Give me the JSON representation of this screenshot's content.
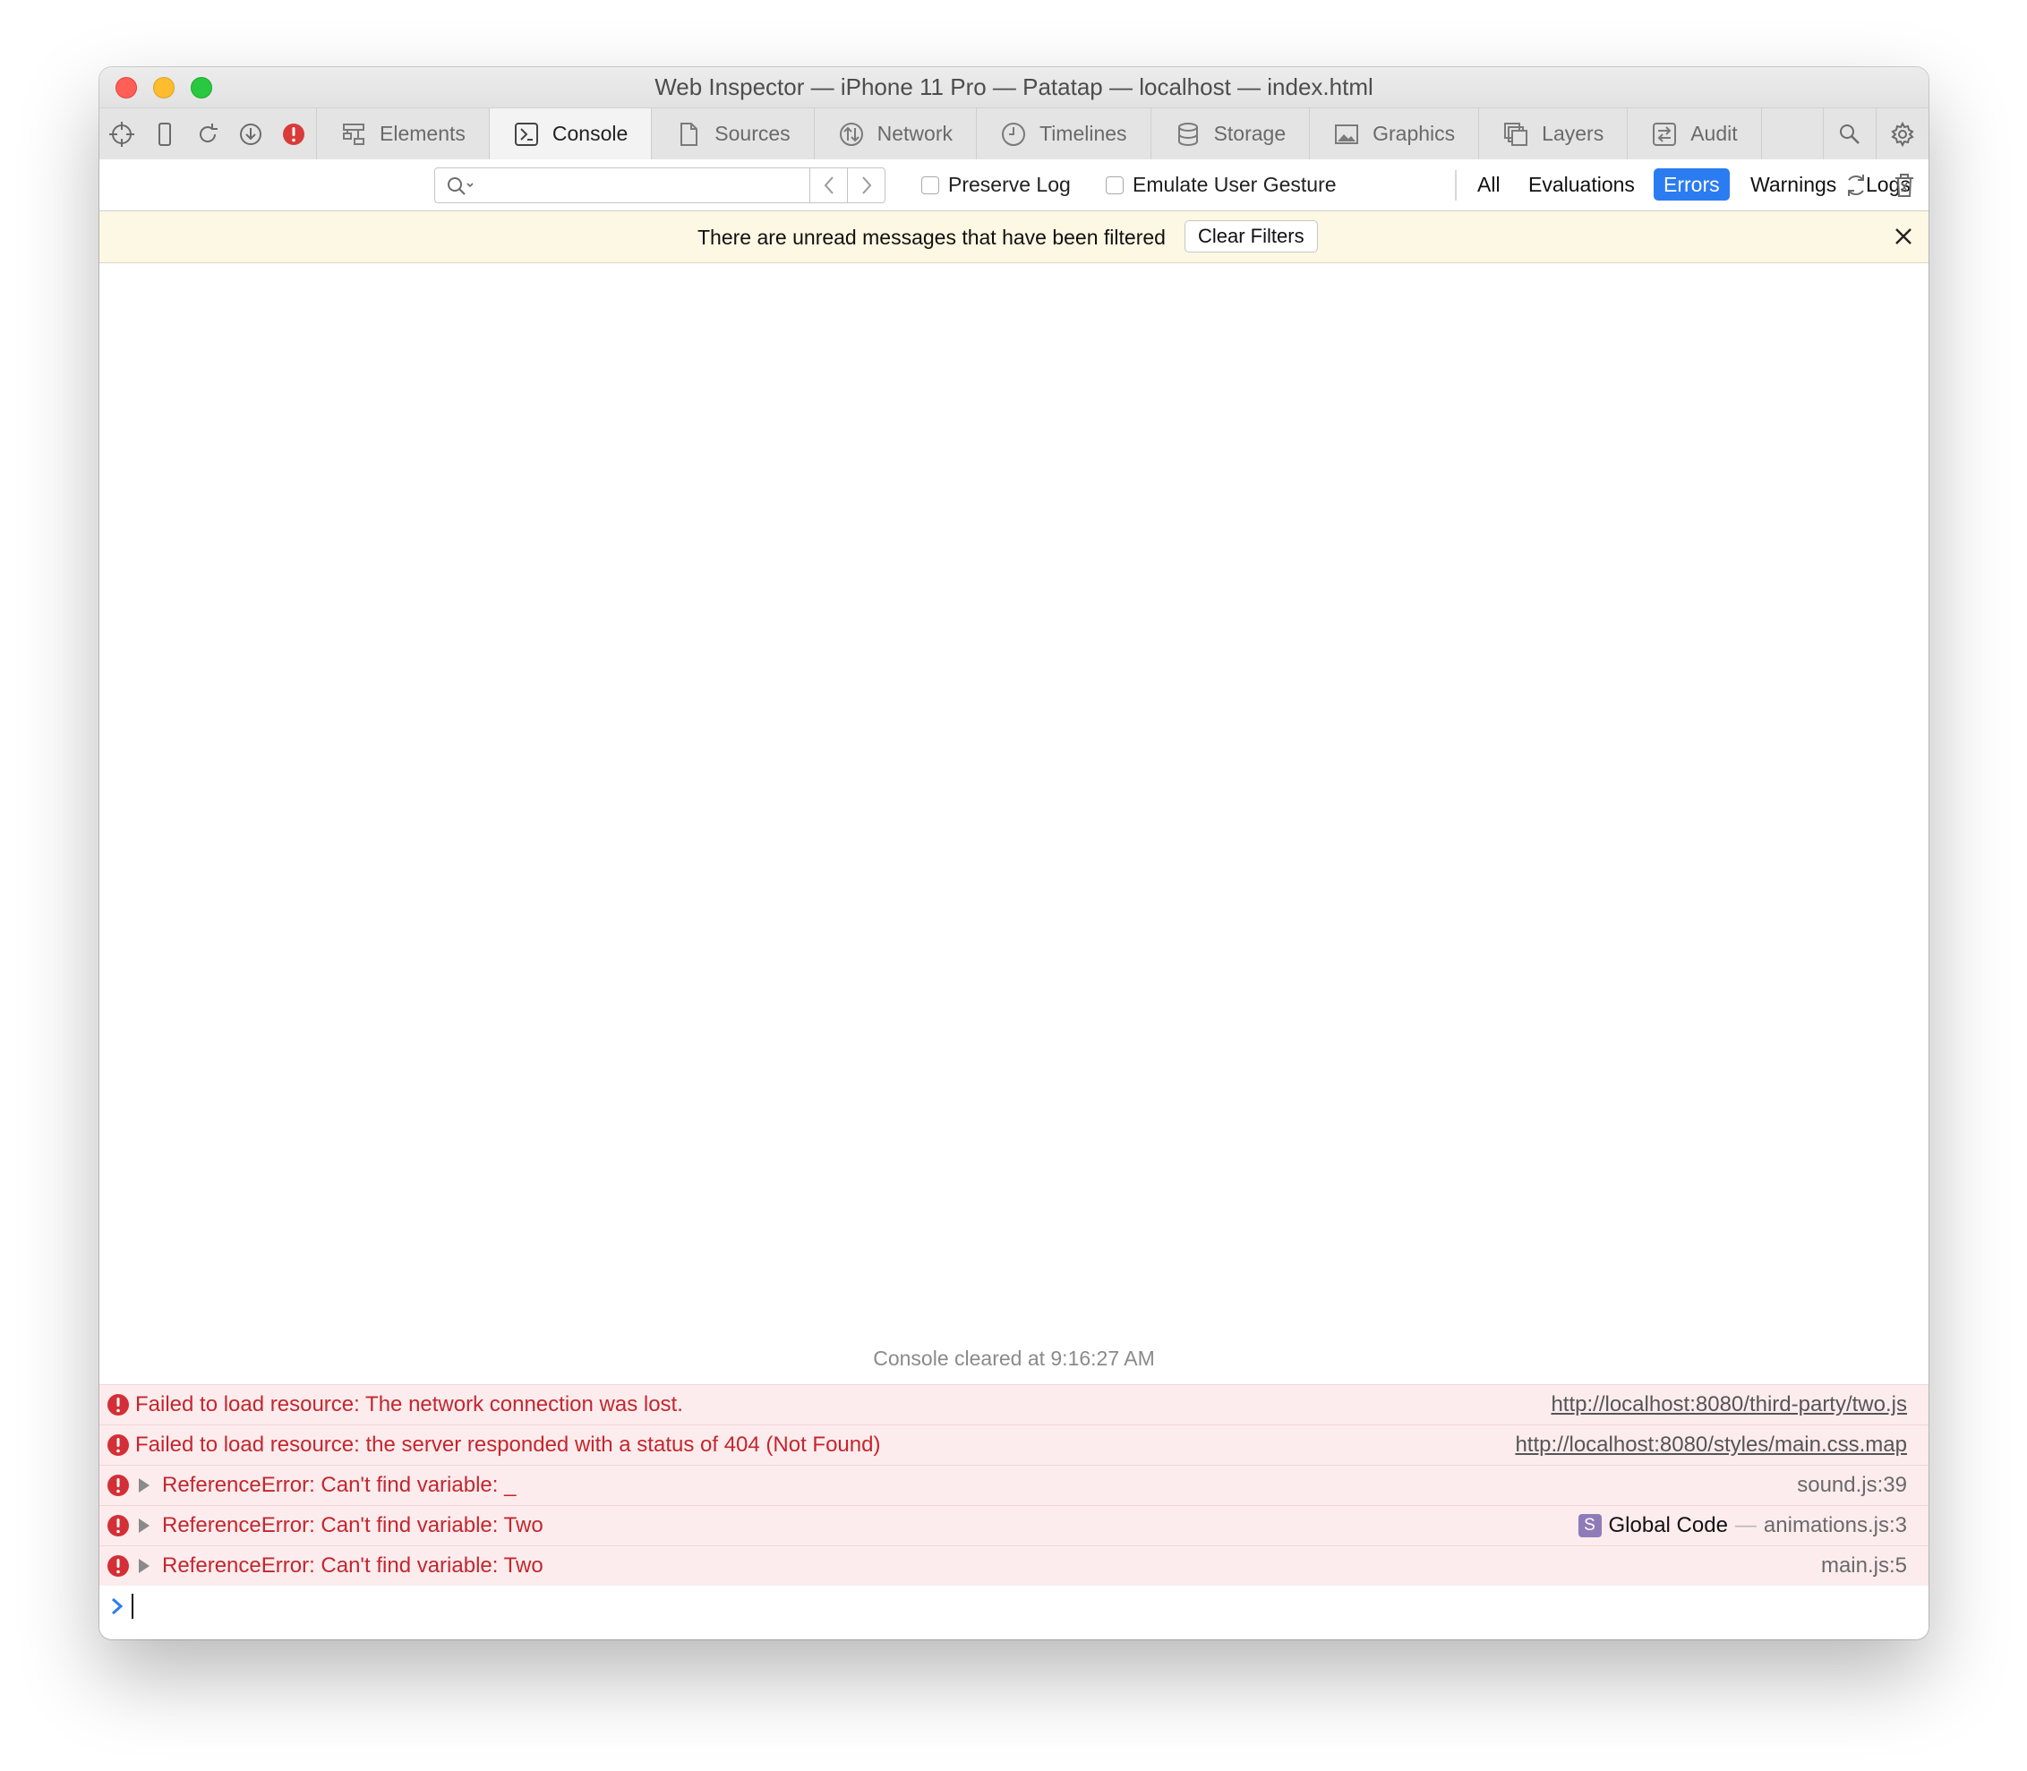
{
  "window": {
    "title": "Web Inspector — iPhone 11 Pro — Patatap — localhost — index.html"
  },
  "toolbar": {
    "tools": [
      "crosshair-icon",
      "device-icon",
      "reload-icon",
      "download-icon",
      "error-badge-icon"
    ],
    "tabs": [
      {
        "label": "Elements",
        "icon": "elements-icon",
        "active": false
      },
      {
        "label": "Console",
        "icon": "console-icon",
        "active": true
      },
      {
        "label": "Sources",
        "icon": "sources-icon",
        "active": false
      },
      {
        "label": "Network",
        "icon": "network-icon",
        "active": false
      },
      {
        "label": "Timelines",
        "icon": "timelines-icon",
        "active": false
      },
      {
        "label": "Storage",
        "icon": "storage-icon",
        "active": false
      },
      {
        "label": "Graphics",
        "icon": "graphics-icon",
        "active": false
      },
      {
        "label": "Layers",
        "icon": "layers-icon",
        "active": false
      },
      {
        "label": "Audit",
        "icon": "audit-icon",
        "active": false
      }
    ],
    "end_icons": [
      "search-icon",
      "gear-icon"
    ]
  },
  "filter": {
    "search_value": "",
    "preserve_log": {
      "label": "Preserve Log",
      "checked": false
    },
    "emulate_gesture": {
      "label": "Emulate User Gesture",
      "checked": false
    },
    "levels": [
      "All",
      "Evaluations",
      "Errors",
      "Warnings",
      "Logs"
    ],
    "active_level": "Errors"
  },
  "banner": {
    "text": "There are unread messages that have been filtered",
    "button": "Clear Filters"
  },
  "console": {
    "cleared": "Console cleared at 9:16:27 AM",
    "messages": [
      {
        "text": "Failed to load resource: The network connection was lost.",
        "source": "http://localhost:8080/third-party/two.js",
        "expandable": false
      },
      {
        "text": "Failed to load resource: the server responded with a status of 404 (Not Found)",
        "source": "http://localhost:8080/styles/main.css.map",
        "expandable": false
      },
      {
        "text": "ReferenceError: Can't find variable: _",
        "source": "sound.js:39",
        "expandable": true
      },
      {
        "text": "ReferenceError: Can't find variable: Two",
        "frame_badge": "S",
        "frame_name": "Global Code",
        "frame_sep": "—",
        "source": "animations.js:3",
        "expandable": true
      },
      {
        "text": "ReferenceError: Can't find variable: Two",
        "source": "main.js:5",
        "expandable": true
      }
    ]
  },
  "colors": {
    "accent": "#2b7cf0",
    "error": "#c4262e",
    "error_bg": "#fdeced",
    "banner_bg": "#fdf8e3"
  }
}
